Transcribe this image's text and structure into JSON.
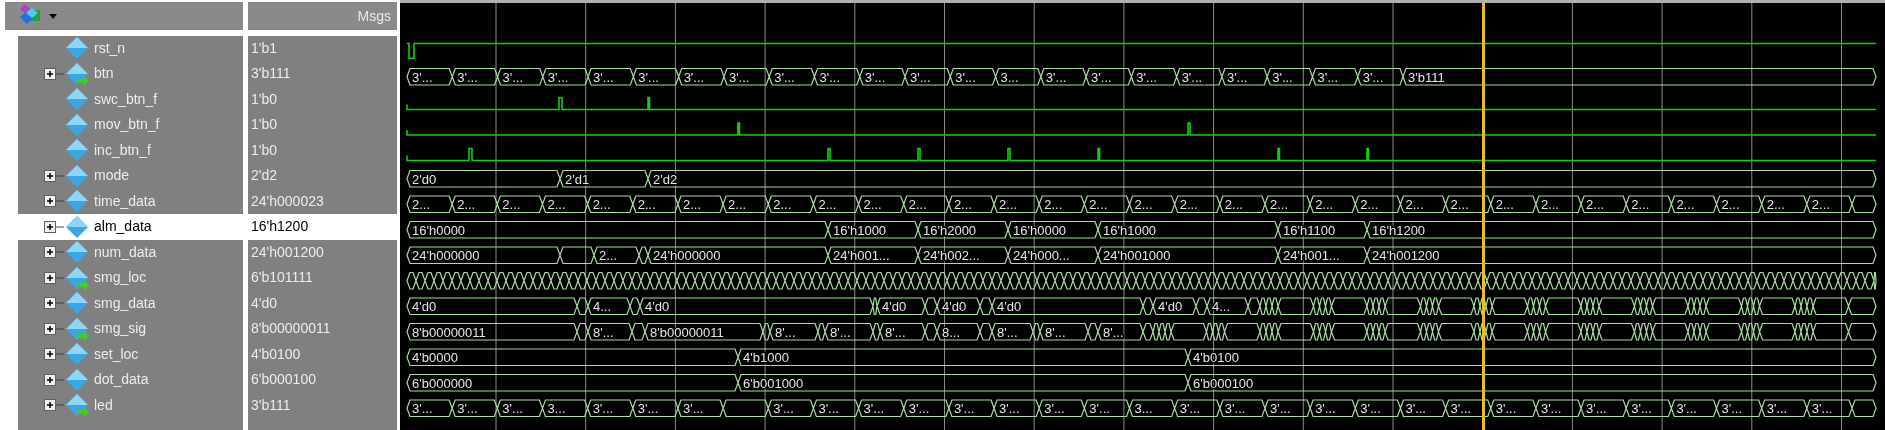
{
  "header": {
    "msgs_label": "Msgs"
  },
  "signals": [
    {
      "name": "rst_n",
      "value": "1'b1",
      "expandable": false,
      "arrow": false,
      "selected": false,
      "kind": "bit"
    },
    {
      "name": "btn",
      "value": "3'b111",
      "expandable": true,
      "arrow": true,
      "selected": false,
      "kind": "bus",
      "wave_labels": [
        "3'...",
        "3'...",
        "3'...",
        "3'...",
        "3'...",
        "3'...",
        "3'...",
        "3'...",
        "3'...",
        "3'...",
        "3'...",
        "3'...",
        "3'...",
        "3...",
        "3'...",
        "3'...",
        "3'...",
        "3'...",
        "3'...",
        "3'...",
        "3'...",
        "3'...",
        "3'b111"
      ]
    },
    {
      "name": "swc_btn_f",
      "value": "1'b0",
      "expandable": false,
      "arrow": false,
      "selected": false,
      "kind": "bit"
    },
    {
      "name": "mov_btn_f",
      "value": "1'b0",
      "expandable": false,
      "arrow": false,
      "selected": false,
      "kind": "bit"
    },
    {
      "name": "inc_btn_f",
      "value": "1'b0",
      "expandable": false,
      "arrow": false,
      "selected": false,
      "kind": "bit"
    },
    {
      "name": "mode",
      "value": "2'd2",
      "expandable": true,
      "arrow": false,
      "selected": false,
      "kind": "bus",
      "wave_labels": [
        "2'd0",
        "2'd1",
        "2'd2"
      ]
    },
    {
      "name": "time_data",
      "value": "24'h000023",
      "expandable": true,
      "arrow": false,
      "selected": false,
      "kind": "bus",
      "wave_labels": [
        "2...",
        "2...",
        "2...",
        "2...",
        "2...",
        "2...",
        "2...",
        "2...",
        "2...",
        "2...",
        "2...",
        "2...",
        "2...",
        "2...",
        "2...",
        "2...",
        "2...",
        "2...",
        "2...",
        "2...",
        "2...",
        "2...",
        "2...",
        "2...",
        "2...",
        "2...",
        "2...",
        "2...",
        "2...",
        "2...",
        "2...",
        "2..."
      ]
    },
    {
      "name": "alm_data",
      "value": "16'h1200",
      "expandable": true,
      "arrow": false,
      "selected": true,
      "kind": "bus",
      "wave_labels": [
        "16'h0000",
        "16'h1000",
        "16'h2000",
        "16'h0000",
        "16'h1000",
        "16'h1100",
        "16'h1200"
      ]
    },
    {
      "name": "num_data",
      "value": "24'h001200",
      "expandable": true,
      "arrow": false,
      "selected": false,
      "kind": "bus",
      "wave_labels": [
        "24'h000000",
        "2...",
        "24'h000000",
        "24'h001...",
        "24'h002...",
        "24'h000...",
        "24'h001000",
        "24'h001...",
        "24'h001200"
      ]
    },
    {
      "name": "smg_loc",
      "value": "6'b101111",
      "expandable": true,
      "arrow": true,
      "selected": false,
      "kind": "bus"
    },
    {
      "name": "smg_data",
      "value": "4'd0",
      "expandable": true,
      "arrow": false,
      "selected": false,
      "kind": "bus",
      "wave_labels": [
        "4'd0",
        "4...",
        "4'd0",
        "4'd0",
        "4'd0",
        "4'd0",
        "4'd0",
        "4..."
      ]
    },
    {
      "name": "smg_sig",
      "value": "8'b00000011",
      "expandable": true,
      "arrow": true,
      "selected": false,
      "kind": "bus",
      "wave_labels": [
        "8'b00000011",
        "8'...",
        "8'b00000011",
        "8'...",
        "8'...",
        "8'...",
        "8...",
        "8'...",
        "8'...",
        "8'..."
      ]
    },
    {
      "name": "set_loc",
      "value": "4'b0100",
      "expandable": true,
      "arrow": false,
      "selected": false,
      "kind": "bus",
      "wave_labels": [
        "4'b0000",
        "4'b1000",
        "4'b0100"
      ]
    },
    {
      "name": "dot_data",
      "value": "6'b000100",
      "expandable": true,
      "arrow": false,
      "selected": false,
      "kind": "bus",
      "wave_labels": [
        "6'b000000",
        "6'b001000",
        "6'b000100"
      ]
    },
    {
      "name": "led",
      "value": "3'b111",
      "expandable": true,
      "arrow": true,
      "selected": false,
      "kind": "bus",
      "wave_labels": [
        "3'...",
        "3'...",
        "3'...",
        "3...",
        "3'...",
        "3'...",
        "3'...",
        "3'...",
        "3'...",
        "3'...",
        "3'...",
        "3'...",
        "3'...",
        "3'...",
        "3'...",
        "3...",
        "3'...",
        "3'...",
        "3'...",
        "3'...",
        "3'...",
        "3'...",
        "3'...",
        "3'...",
        "3'...",
        "3'...",
        "3'...",
        "3'...",
        "3'...",
        "3'...",
        "3'..."
      ]
    }
  ]
}
